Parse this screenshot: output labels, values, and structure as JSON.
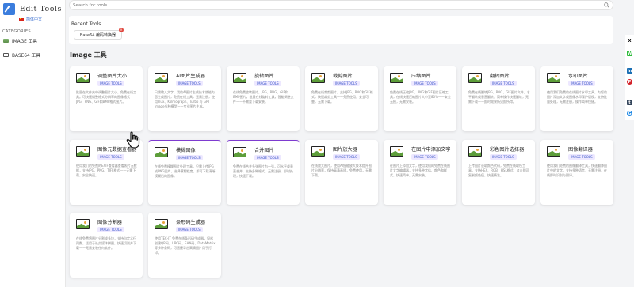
{
  "app": {
    "title": "Edit Tools",
    "language": "简体中文"
  },
  "sidebar": {
    "category_title": "CATEGORIES",
    "items": [
      {
        "label": "IMAGE 工具",
        "icon": "image-icon"
      },
      {
        "label": "BASE64 工具",
        "icon": "code-icon"
      }
    ]
  },
  "search": {
    "placeholder": "Search for tools..."
  },
  "recent": {
    "title": "Recent Tools",
    "items": [
      {
        "label": "Base64 编码转换器"
      }
    ]
  },
  "section": {
    "title": "Image 工具"
  },
  "cards": [
    {
      "name": "调整图片大小",
      "badge": "IMAGE TOOLS",
      "desc": "批量在文件夹中调整图片大小，免费在线工具。可快速调整格式分辨率的图像格式JPG、PNG、GIF和BMP格式图片。"
    },
    {
      "name": "AI图片生成器",
      "badge": "IMAGE TOOLS",
      "desc": "只需输入文字，我的AI图片生成技术就能为您生成图片，免费在线工具，无需注册，使用Flux、Kolmograph、Turbo 与 GPT Image多种模型——专业图片生成。"
    },
    {
      "name": "旋转图片",
      "badge": "IMAGE TOOLS",
      "desc": "在线免费旋转图片，JPG、PNG、GIF和BMP图片，批量在线旋转工具，智能调整文件——不需要下载安装。"
    },
    {
      "name": "裁剪图片",
      "badge": "IMAGE TOOLS",
      "desc": "免费在线裁剪图片，支持JPG、PNG和GIF格式，快速裁剪工具——免费使用，安全可靠，无需下载。"
    },
    {
      "name": "压缩图片",
      "badge": "IMAGE TOOLS",
      "desc": "免费在线压缩JPG、PNG和GIF图片压缩工具，在线快速压缩图片大小至80%——安全无损，无需安装。"
    },
    {
      "name": "翻转图片",
      "badge": "IMAGE TOOLS",
      "desc": "免费在线翻转JPG、PNG、GIF图片文件，水平翻转或垂直翻转，简单操作快速翻转，无需下载——即时效果所见即所得。"
    },
    {
      "name": "水印图片",
      "badge": "IMAGE TOOLS",
      "desc": "使用我们免费的在线图片水印工具，为您的图片添加文字或图像水印保护版权，支持批量处理，无需注册，操作简单快捷。"
    },
    {
      "name": "图像元数据查看器",
      "badge": "IMAGE TOOLS",
      "desc": "使用我们的免费的EXIF查看器查看照片元数据，支持JPG、PNG、TIFF格式——无需下载，安全快速。"
    },
    {
      "name": "模糊图像",
      "badge": "IMAGE TOOLS",
      "desc": "在线免费模糊图片处理工具，只需上传JPG或PNG图片，选择模糊程度，即可下载清晰模糊后的图像。"
    },
    {
      "name": "合并图片",
      "badge": "IMAGE TOOLS",
      "desc": "免费在线合并多张图片为一张，可水平或垂直合并，支持多种格式，无需注册，即时处理，快速下载。"
    },
    {
      "name": "图片放大器",
      "badge": "IMAGE TOOLS",
      "desc": "在线放大图片，使用AI智能放大技术提升图片分辨率，保持高清画质，免费使用，无需下载。"
    },
    {
      "name": "在图片中添加文字",
      "badge": "IMAGE TOOLS",
      "desc": "在图片上添加文字，使用我们的免费在线图片文字编辑器，支持多种字体、颜色和样式，快速简单，无需安装。"
    },
    {
      "name": "彩色图片选择器",
      "badge": "IMAGE TOOLS",
      "desc": "上传图片获取颜色代码，免费在线取色工具，支持HEX、RGB、HSL格式，点击即可复制颜色值，快速精准。"
    },
    {
      "name": "图像翻译器",
      "badge": "IMAGE TOOLS",
      "desc": "使用我们免费的图像翻译工具，快速翻译图片中的文字，支持多种语言，无需注册，在线即时识别与翻译。"
    },
    {
      "name": "图像分割器",
      "badge": "IMAGE TOOLS",
      "desc": "在线免费将图片分割成多块，支持自定义行列数，适用于社交媒体拼图，快速切割并下载——无需安装任何软件。"
    },
    {
      "name": "条形码生成器",
      "badge": "IMAGE TOOLS",
      "desc": "使用TEC-IT 免费在线条形码生成器，轻松创建QR码、UPC码、EAN码、DataMatrix等多种条码，可直接导出高清图片用于打印。"
    }
  ],
  "share": [
    "X",
    "W",
    "in",
    "P",
    "t",
    "G"
  ],
  "colors": {
    "accent": "#3b7ddd",
    "badge_bg": "#ede8ff",
    "badge_text": "#3b55c9",
    "selected_border": "#7e3bd0"
  }
}
